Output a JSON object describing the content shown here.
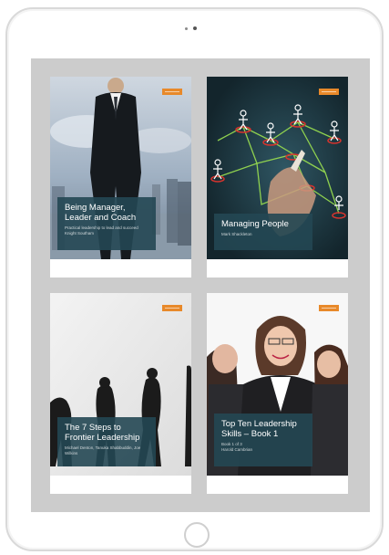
{
  "books": [
    {
      "title": "Being Manager, Leader and Coach",
      "subtitle": "Practical leadership to lead and succeed",
      "author": "Knight Southam",
      "accent": "#234753"
    },
    {
      "title": "Managing People",
      "subtitle": "Mark Shackleton",
      "author": "",
      "accent": "#234753"
    },
    {
      "title": "The 7 Steps to Frontier Leadership",
      "subtitle": "Michael Denton, Tanuka Shabbuddin, Joe",
      "author": "Wilkins",
      "accent": "#234753"
    },
    {
      "title": "Top Ten Leadership Skills – Book 1",
      "subtitle": "Book 1 of 3",
      "author": "Harold Cambrian",
      "accent": "#234753"
    }
  ],
  "colors": {
    "badge": "#e8892a",
    "screen_bg": "#cccccc",
    "frame": "#d9d9d9"
  },
  "icons": [
    "home-button-icon",
    "camera-icon"
  ]
}
